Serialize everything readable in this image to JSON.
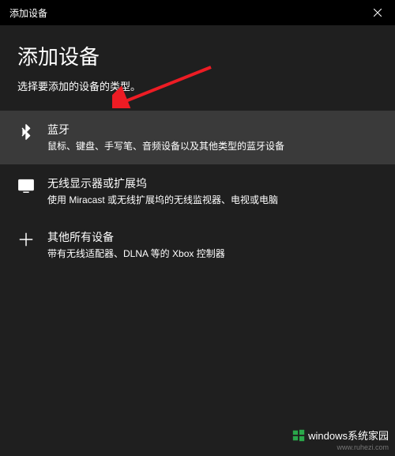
{
  "titlebar": {
    "title": "添加设备"
  },
  "header": {
    "title": "添加设备",
    "subtitle": "选择要添加的设备的类型。"
  },
  "options": [
    {
      "title": "蓝牙",
      "desc": "鼠标、键盘、手写笔、音频设备以及其他类型的蓝牙设备",
      "selected": true,
      "icon": "bluetooth-icon"
    },
    {
      "title": "无线显示器或扩展坞",
      "desc": "使用 Miracast 或无线扩展坞的无线监视器、电视或电脑",
      "selected": false,
      "icon": "display-icon"
    },
    {
      "title": "其他所有设备",
      "desc": "带有无线适配器、DLNA 等的 Xbox 控制器",
      "selected": false,
      "icon": "plus-icon"
    }
  ],
  "watermark": {
    "text": "windows系统家园",
    "url": "www.ruhezi.com"
  },
  "colors": {
    "background": "#1f1f1f",
    "titlebar": "#000000",
    "selected": "#3a3a3a",
    "text": "#ffffff",
    "arrow": "#ed1c24",
    "accent": "#2aa84a"
  }
}
